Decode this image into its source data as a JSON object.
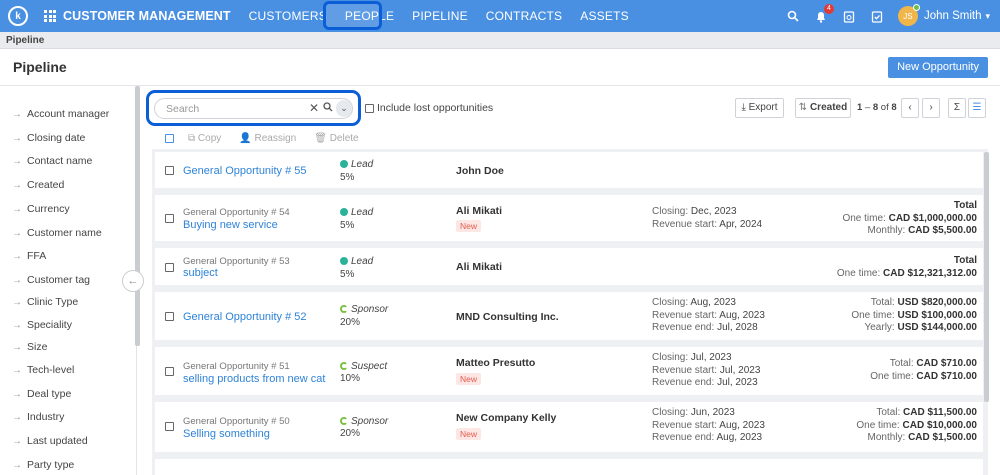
{
  "topbar": {
    "logo": "k",
    "app_title": "CUSTOMER MANAGEMENT",
    "nav": [
      "CUSTOMERS",
      "PEOPLE",
      "PIPELINE",
      "CONTRACTS",
      "ASSETS"
    ],
    "notification_count": "4",
    "user_initials": "JS",
    "user_name": "John Smith"
  },
  "breadcrumb": "Pipeline",
  "page": {
    "title": "Pipeline",
    "new_button": "New Opportunity"
  },
  "filters": [
    "Account manager",
    "Closing date",
    "Contact name",
    "Created",
    "Currency",
    "Customer name",
    "FFA",
    "Customer tag",
    "Clinic Type",
    "Speciality",
    "Size",
    "Tech-level",
    "Deal type",
    "Industry",
    "Last updated",
    "Party type"
  ],
  "search": {
    "placeholder": "Search"
  },
  "include_lost": "Include lost opportunities",
  "toolbar": {
    "export": "Export",
    "sort": "Created",
    "range_start": "1",
    "range_end": "8",
    "range_total": "8",
    "sum_icon": "Σ"
  },
  "bulk_actions": [
    "Copy",
    "Reassign",
    "Delete"
  ],
  "opportunities": [
    {
      "sub": "",
      "name": "General Opportunity # 55",
      "stage": "Lead",
      "prob": "5%",
      "contact": "John Doe",
      "new": "",
      "dates": [],
      "totals": []
    },
    {
      "sub": "General Opportunity # 54",
      "name": "Buying new service",
      "stage": "Lead",
      "prob": "5%",
      "contact": "Ali Mikati",
      "new": "New",
      "dates": [
        [
          "Closing:",
          "Dec, 2023"
        ],
        [
          "Revenue start:",
          "Apr, 2024"
        ]
      ],
      "totals": [
        [
          "",
          "Total"
        ],
        [
          "One time:",
          "CAD $1,000,000.00"
        ],
        [
          "Monthly:",
          "CAD $5,500.00"
        ]
      ]
    },
    {
      "sub": "General Opportunity # 53",
      "name": "subject",
      "stage": "Lead",
      "prob": "5%",
      "contact": "Ali Mikati",
      "new": "",
      "dates": [],
      "totals": [
        [
          "",
          "Total"
        ],
        [
          "One time:",
          "CAD $12,321,312.00"
        ]
      ]
    },
    {
      "sub": "",
      "name": "General Opportunity # 52",
      "stage": "Sponsor",
      "prob": "20%",
      "contact": "MND Consulting Inc.",
      "new": "",
      "dates": [
        [
          "Closing:",
          "Aug, 2023"
        ],
        [
          "Revenue start:",
          "Aug, 2023"
        ],
        [
          "Revenue end:",
          "Jul, 2028"
        ]
      ],
      "totals": [
        [
          "Total:",
          "USD $820,000.00"
        ],
        [
          "One time:",
          "USD $100,000.00"
        ],
        [
          "Yearly:",
          "USD $144,000.00"
        ]
      ]
    },
    {
      "sub": "General Opportunity # 51",
      "name": "selling products from new cat",
      "stage": "Suspect",
      "prob": "10%",
      "contact": "Matteo Presutto",
      "new": "New",
      "dates": [
        [
          "Closing:",
          "Jul, 2023"
        ],
        [
          "Revenue start:",
          "Jul, 2023"
        ],
        [
          "Revenue end:",
          "Jul, 2023"
        ]
      ],
      "totals": [
        [
          "Total:",
          "CAD $710.00"
        ],
        [
          "One time:",
          "CAD $710.00"
        ]
      ]
    },
    {
      "sub": "General Opportunity # 50",
      "name": "Selling something",
      "stage": "Sponsor",
      "prob": "20%",
      "contact": "New Company Kelly",
      "new": "New",
      "dates": [
        [
          "Closing:",
          "Jun, 2023"
        ],
        [
          "Revenue start:",
          "Aug, 2023"
        ],
        [
          "Revenue end:",
          "Aug, 2023"
        ]
      ],
      "totals": [
        [
          "Total:",
          "CAD $11,500.00"
        ],
        [
          "One time:",
          "CAD $10,000.00"
        ],
        [
          "Monthly:",
          "CAD $1,500.00"
        ]
      ]
    }
  ]
}
